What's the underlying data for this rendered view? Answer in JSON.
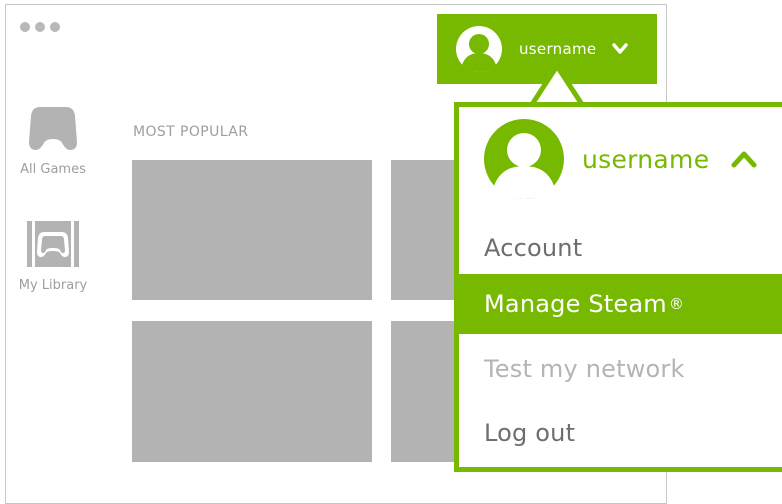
{
  "window": {
    "controls": [
      "close",
      "minimize",
      "maximize"
    ]
  },
  "header": {
    "username": "username",
    "avatar_icon": "user-avatar-icon",
    "toggle_icon": "chevron-down-icon"
  },
  "sidebar": {
    "items": [
      {
        "label": "All Games",
        "icon": "gamepad-icon"
      },
      {
        "label": "My Library",
        "icon": "library-gamepad-icon"
      }
    ]
  },
  "main": {
    "section_title": "MOST POPULAR",
    "tiles": 4
  },
  "dropdown": {
    "username": "username",
    "avatar_icon": "user-avatar-icon",
    "toggle_icon": "chevron-up-icon",
    "items": [
      {
        "label": "Account",
        "state": "normal"
      },
      {
        "label": "Manage Steam",
        "suffix": "®",
        "state": "highlighted"
      },
      {
        "label": "Test my network",
        "state": "disabled"
      },
      {
        "label": "Log out",
        "state": "normal"
      }
    ]
  },
  "colors": {
    "accent": "#76b900",
    "placeholder": "#b3b3b3",
    "text_muted": "#9e9e9e",
    "text_item": "#6e6e6e"
  }
}
